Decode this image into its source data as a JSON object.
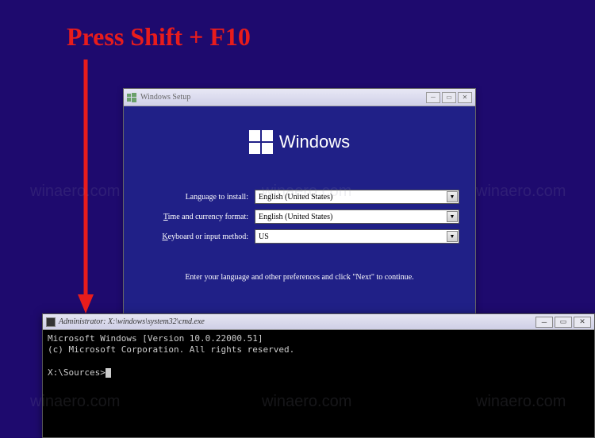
{
  "annotation": "Press Shift + F10",
  "watermark": "winaero.com",
  "setup": {
    "title": "Windows Setup",
    "logo_text": "Windows",
    "fields": {
      "language_label": "Language to install:",
      "language_value": "English (United States)",
      "time_label_pre": "T",
      "time_label_post": "ime and currency format:",
      "time_value": "English (United States)",
      "keyboard_label_pre": "K",
      "keyboard_label_post": "eyboard or input method:",
      "keyboard_value": "US"
    },
    "hint": "Enter your language and other preferences and click \"Next\" to continue."
  },
  "cmd": {
    "title": "Administrator: X:\\windows\\system32\\cmd.exe",
    "line1": "Microsoft Windows [Version 10.0.22000.51]",
    "line2": "(c) Microsoft Corporation. All rights reserved.",
    "prompt": "X:\\Sources>"
  }
}
